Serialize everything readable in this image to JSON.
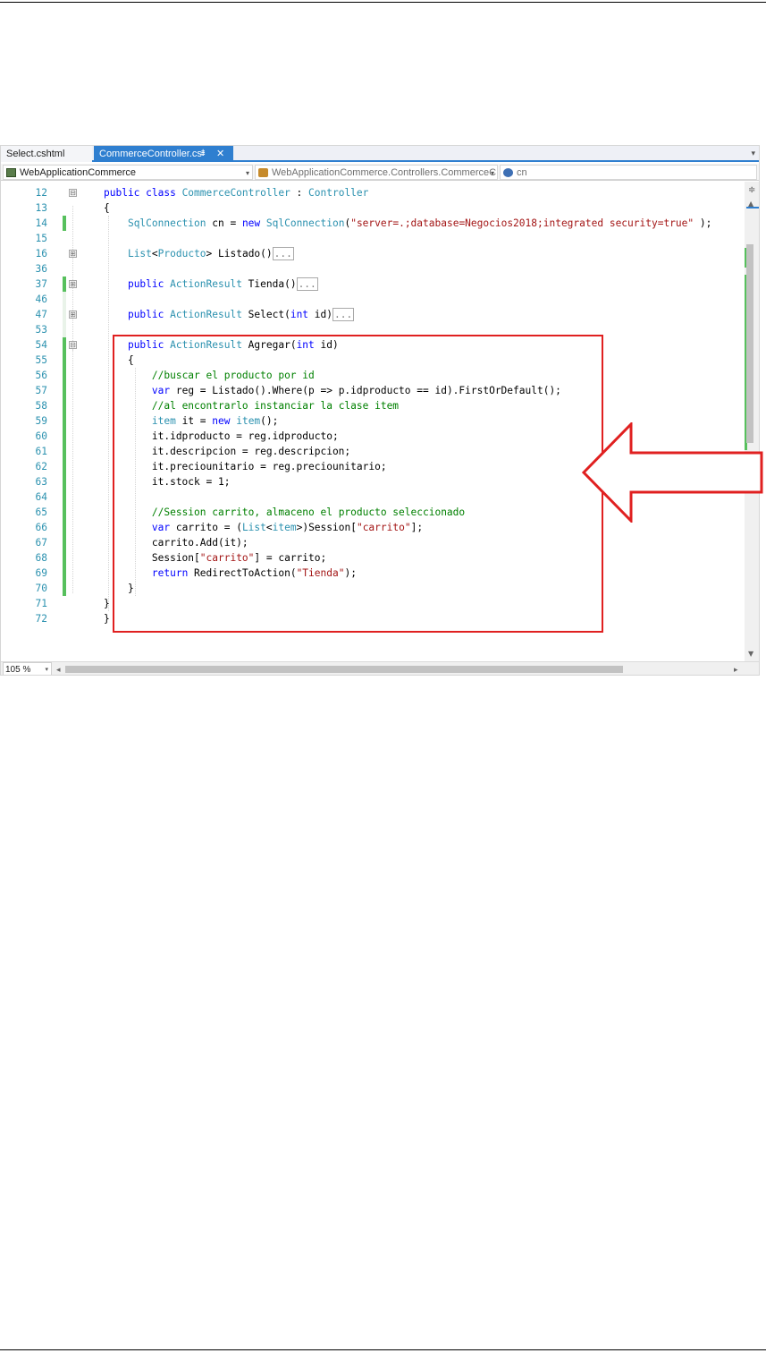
{
  "tabs": [
    {
      "label": "Select.cshtml",
      "active": false
    },
    {
      "label": "CommerceController.cs",
      "active": true,
      "pin_glyph": "⇟",
      "close_glyph": "✕"
    }
  ],
  "tab_overflow_glyph": "▾",
  "navbar": {
    "project": "WebApplicationCommerce",
    "type": "WebApplicationCommerce.Controllers.CommerceC",
    "member": "cn",
    "dropdown_glyph": "▾"
  },
  "colors": {
    "keyword": "#0000ff",
    "type": "#2b91af",
    "string": "#a31515",
    "comment": "#008000",
    "line_number": "#2b91af",
    "change_marker": "#57c05d",
    "highlight": "#e02020",
    "active_tab": "#2f7fd0"
  },
  "editor": {
    "lines": [
      {
        "n": "12",
        "fold": "⊟",
        "tokens": [
          {
            "c": "kw",
            "t": "public class "
          },
          {
            "c": "ty",
            "t": "CommerceController"
          },
          {
            "c": "pl",
            "t": " : "
          },
          {
            "c": "ty",
            "t": "Controller"
          }
        ]
      },
      {
        "n": "13",
        "tokens": [
          {
            "c": "pl",
            "t": "{"
          }
        ]
      },
      {
        "n": "14",
        "chg": "green",
        "tokens": [
          {
            "c": "pl",
            "t": "    "
          },
          {
            "c": "ty",
            "t": "SqlConnection"
          },
          {
            "c": "pl",
            "t": " cn = "
          },
          {
            "c": "kw",
            "t": "new "
          },
          {
            "c": "ty",
            "t": "SqlConnection"
          },
          {
            "c": "pl",
            "t": "("
          },
          {
            "c": "st",
            "t": "\"server=.;database=Negocios2018;integrated security=true\""
          },
          {
            "c": "pl",
            "t": " );"
          }
        ]
      },
      {
        "n": "15",
        "tokens": []
      },
      {
        "n": "16",
        "fold": "⊞",
        "tokens": [
          {
            "c": "pl",
            "t": "    "
          },
          {
            "c": "ty",
            "t": "List"
          },
          {
            "c": "pl",
            "t": "<"
          },
          {
            "c": "ty",
            "t": "Producto"
          },
          {
            "c": "pl",
            "t": "> Listado()"
          },
          {
            "c": "collapsed",
            "t": "..."
          }
        ]
      },
      {
        "n": "36",
        "tokens": []
      },
      {
        "n": "37",
        "chg": "green",
        "fold": "⊞",
        "tokens": [
          {
            "c": "pl",
            "t": "    "
          },
          {
            "c": "kw",
            "t": "public "
          },
          {
            "c": "ty",
            "t": "ActionResult"
          },
          {
            "c": "pl",
            "t": " Tienda()"
          },
          {
            "c": "collapsed",
            "t": "..."
          }
        ]
      },
      {
        "n": "46",
        "chg": "dim",
        "tokens": []
      },
      {
        "n": "47",
        "chg": "dim",
        "fold": "⊞",
        "tokens": [
          {
            "c": "pl",
            "t": "    "
          },
          {
            "c": "kw",
            "t": "public "
          },
          {
            "c": "ty",
            "t": "ActionResult"
          },
          {
            "c": "pl",
            "t": " Select("
          },
          {
            "c": "kw",
            "t": "int"
          },
          {
            "c": "pl",
            "t": " id)"
          },
          {
            "c": "collapsed",
            "t": "..."
          }
        ]
      },
      {
        "n": "53",
        "chg": "dim",
        "tokens": []
      },
      {
        "n": "54",
        "chg": "green",
        "fold": "⊟",
        "tokens": [
          {
            "c": "pl",
            "t": "    "
          },
          {
            "c": "kw",
            "t": "public "
          },
          {
            "c": "ty",
            "t": "ActionResult"
          },
          {
            "c": "pl",
            "t": " Agregar("
          },
          {
            "c": "kw",
            "t": "int"
          },
          {
            "c": "pl",
            "t": " id)"
          }
        ]
      },
      {
        "n": "55",
        "chg": "green",
        "tokens": [
          {
            "c": "pl",
            "t": "    {"
          }
        ]
      },
      {
        "n": "56",
        "chg": "green",
        "tokens": [
          {
            "c": "pl",
            "t": "        "
          },
          {
            "c": "cm",
            "t": "//buscar el producto por id"
          }
        ]
      },
      {
        "n": "57",
        "chg": "green",
        "tokens": [
          {
            "c": "pl",
            "t": "        "
          },
          {
            "c": "kw",
            "t": "var"
          },
          {
            "c": "pl",
            "t": " reg = Listado().Where(p => p.idproducto == id).FirstOrDefault();"
          }
        ]
      },
      {
        "n": "58",
        "chg": "green",
        "tokens": [
          {
            "c": "pl",
            "t": "        "
          },
          {
            "c": "cm",
            "t": "//al encontrarlo instanciar la clase item"
          }
        ]
      },
      {
        "n": "59",
        "chg": "green",
        "tokens": [
          {
            "c": "pl",
            "t": "        "
          },
          {
            "c": "ty",
            "t": "item"
          },
          {
            "c": "pl",
            "t": " it = "
          },
          {
            "c": "kw",
            "t": "new "
          },
          {
            "c": "ty",
            "t": "item"
          },
          {
            "c": "pl",
            "t": "();"
          }
        ]
      },
      {
        "n": "60",
        "chg": "green",
        "tokens": [
          {
            "c": "pl",
            "t": "        it.idproducto = reg.idproducto;"
          }
        ]
      },
      {
        "n": "61",
        "chg": "green",
        "tokens": [
          {
            "c": "pl",
            "t": "        it.descripcion = reg.descripcion;"
          }
        ]
      },
      {
        "n": "62",
        "chg": "green",
        "tokens": [
          {
            "c": "pl",
            "t": "        it.preciounitario = reg.preciounitario;"
          }
        ]
      },
      {
        "n": "63",
        "chg": "green",
        "tokens": [
          {
            "c": "pl",
            "t": "        it.stock = 1;"
          }
        ]
      },
      {
        "n": "64",
        "chg": "green",
        "tokens": []
      },
      {
        "n": "65",
        "chg": "green",
        "tokens": [
          {
            "c": "pl",
            "t": "        "
          },
          {
            "c": "cm",
            "t": "//Session carrito, almaceno el producto seleccionado"
          }
        ]
      },
      {
        "n": "66",
        "chg": "green",
        "tokens": [
          {
            "c": "pl",
            "t": "        "
          },
          {
            "c": "kw",
            "t": "var"
          },
          {
            "c": "pl",
            "t": " carrito = ("
          },
          {
            "c": "ty",
            "t": "List"
          },
          {
            "c": "pl",
            "t": "<"
          },
          {
            "c": "ty",
            "t": "item"
          },
          {
            "c": "pl",
            "t": ">)Session["
          },
          {
            "c": "st",
            "t": "\"carrito\""
          },
          {
            "c": "pl",
            "t": "];"
          }
        ]
      },
      {
        "n": "67",
        "chg": "green",
        "tokens": [
          {
            "c": "pl",
            "t": "        carrito.Add(it);"
          }
        ]
      },
      {
        "n": "68",
        "chg": "green",
        "tokens": [
          {
            "c": "pl",
            "t": "        Session["
          },
          {
            "c": "st",
            "t": "\"carrito\""
          },
          {
            "c": "pl",
            "t": "] = carrito;"
          }
        ]
      },
      {
        "n": "69",
        "chg": "green",
        "tokens": [
          {
            "c": "pl",
            "t": "        "
          },
          {
            "c": "kw",
            "t": "return"
          },
          {
            "c": "pl",
            "t": " RedirectToAction("
          },
          {
            "c": "st",
            "t": "\"Tienda\""
          },
          {
            "c": "pl",
            "t": ");"
          }
        ]
      },
      {
        "n": "70",
        "chg": "green",
        "tokens": [
          {
            "c": "pl",
            "t": "    }"
          }
        ]
      },
      {
        "n": "71",
        "tokens": [
          {
            "c": "pl",
            "t": "}"
          }
        ]
      },
      {
        "n": "72",
        "tokens": [
          {
            "c": "pl",
            "t": "}"
          }
        ]
      }
    ]
  },
  "scrollbar": {
    "split_glyph": "≑",
    "up_glyph": "▲",
    "down_glyph": "▼"
  },
  "bottombar": {
    "zoom": "105 %",
    "zoom_dropdown": "▾",
    "left_glyph": "◂",
    "right_glyph": "▸"
  }
}
